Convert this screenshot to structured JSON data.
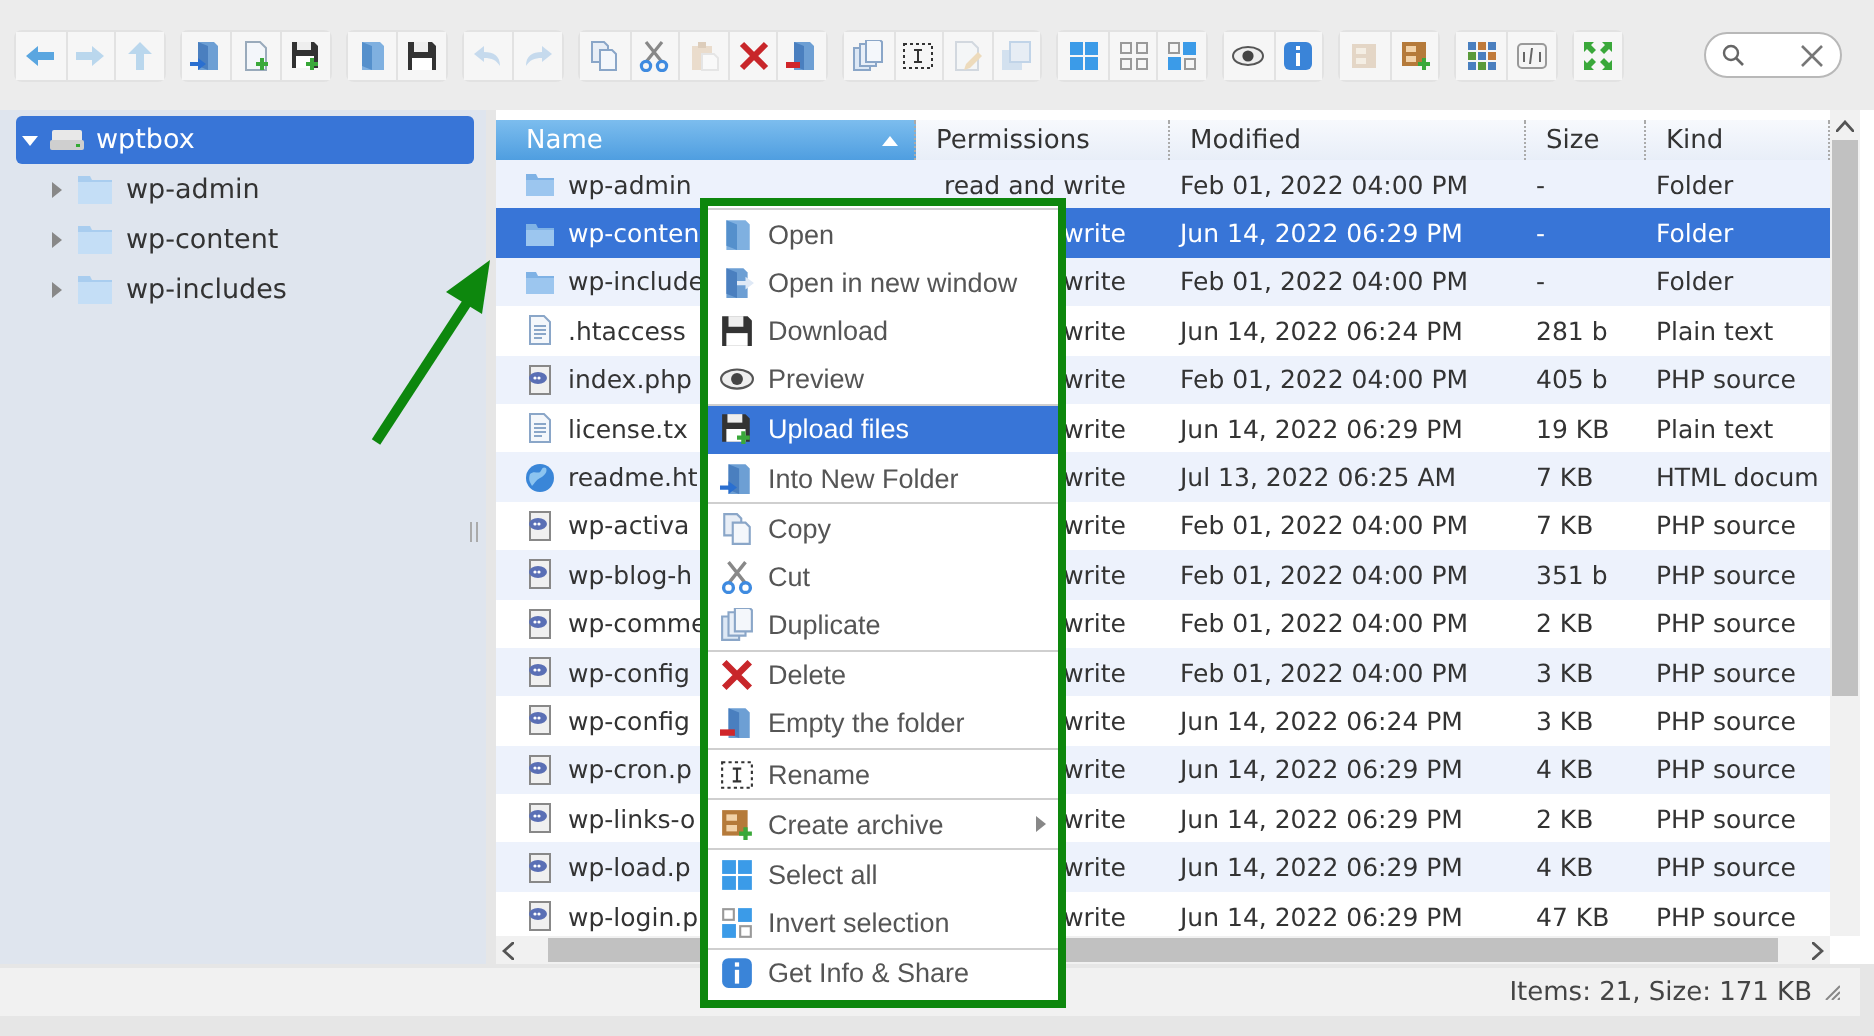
{
  "toolbar": {
    "groups": [
      [
        {
          "kind": "back",
          "disabled": false
        },
        {
          "kind": "forward",
          "disabled": true
        },
        {
          "kind": "up",
          "disabled": true
        }
      ],
      [
        {
          "kind": "mkdir",
          "disabled": false
        },
        {
          "kind": "mkfile",
          "disabled": false
        },
        {
          "kind": "upload",
          "disabled": false
        }
      ],
      [
        {
          "kind": "open",
          "disabled": false
        },
        {
          "kind": "download",
          "disabled": false
        }
      ],
      [
        {
          "kind": "undo",
          "disabled": true
        },
        {
          "kind": "redo",
          "disabled": true
        }
      ],
      [
        {
          "kind": "copy",
          "disabled": false
        },
        {
          "kind": "cut",
          "disabled": false
        },
        {
          "kind": "paste",
          "disabled": true
        },
        {
          "kind": "delete",
          "disabled": false
        },
        {
          "kind": "empty",
          "disabled": false
        }
      ],
      [
        {
          "kind": "duplicate",
          "disabled": false
        },
        {
          "kind": "rename",
          "disabled": false
        },
        {
          "kind": "edit",
          "disabled": true
        },
        {
          "kind": "resize",
          "disabled": true
        }
      ],
      [
        {
          "kind": "selectall",
          "disabled": false
        },
        {
          "kind": "selectnone",
          "disabled": false
        },
        {
          "kind": "selectinvert",
          "disabled": false
        }
      ],
      [
        {
          "kind": "preview",
          "disabled": false
        },
        {
          "kind": "info",
          "disabled": false
        }
      ],
      [
        {
          "kind": "extract",
          "disabled": true
        },
        {
          "kind": "archive",
          "disabled": false
        }
      ],
      [
        {
          "kind": "view",
          "disabled": false
        },
        {
          "kind": "sort",
          "disabled": false
        }
      ],
      [
        {
          "kind": "fullscreen",
          "disabled": false
        }
      ]
    ]
  },
  "tree": {
    "root": {
      "label": "wptbox",
      "selected": true,
      "expanded": true,
      "children": [
        {
          "label": "wp-admin",
          "selected": false,
          "expanded": false
        },
        {
          "label": "wp-content",
          "selected": false,
          "expanded": false
        },
        {
          "label": "wp-includes",
          "selected": false,
          "expanded": false
        }
      ]
    }
  },
  "table": {
    "columns": [
      {
        "label": "Name",
        "sorted": true
      },
      {
        "label": "Permissions",
        "sorted": false
      },
      {
        "label": "Modified",
        "sorted": false
      },
      {
        "label": "Size",
        "sorted": false
      },
      {
        "label": "Kind",
        "sorted": false
      }
    ],
    "rows": [
      {
        "kind": "folder",
        "name": "wp-admin",
        "permissions": "read and write",
        "modified": "Feb 01, 2022 04:00 PM",
        "size": "-",
        "file_type": "Folder",
        "selected": false
      },
      {
        "kind": "folder",
        "name": "wp-conten",
        "permissions": "write",
        "modified": "Jun 14, 2022 06:29 PM",
        "size": "-",
        "file_type": "Folder",
        "selected": true
      },
      {
        "kind": "folder",
        "name": "wp-include",
        "permissions": "write",
        "modified": "Feb 01, 2022 04:00 PM",
        "size": "-",
        "file_type": "Folder",
        "selected": false
      },
      {
        "kind": "text",
        "name": ".htaccess",
        "permissions": "write",
        "modified": "Jun 14, 2022 06:24 PM",
        "size": "281 b",
        "file_type": "Plain text",
        "selected": false
      },
      {
        "kind": "php",
        "name": "index.php",
        "permissions": "write",
        "modified": "Feb 01, 2022 04:00 PM",
        "size": "405 b",
        "file_type": "PHP source",
        "selected": false
      },
      {
        "kind": "text",
        "name": "license.tx",
        "permissions": "write",
        "modified": "Jun 14, 2022 06:29 PM",
        "size": "19 KB",
        "file_type": "Plain text",
        "selected": false
      },
      {
        "kind": "html",
        "name": "readme.ht",
        "permissions": "write",
        "modified": "Jul 13, 2022 06:25 AM",
        "size": "7 KB",
        "file_type": "HTML docum",
        "selected": false
      },
      {
        "kind": "php",
        "name": "wp-activa",
        "permissions": "write",
        "modified": "Feb 01, 2022 04:00 PM",
        "size": "7 KB",
        "file_type": "PHP source",
        "selected": false
      },
      {
        "kind": "php",
        "name": "wp-blog-h",
        "permissions": "write",
        "modified": "Feb 01, 2022 04:00 PM",
        "size": "351 b",
        "file_type": "PHP source",
        "selected": false
      },
      {
        "kind": "php",
        "name": "wp-comme",
        "permissions": "write",
        "modified": "Feb 01, 2022 04:00 PM",
        "size": "2 KB",
        "file_type": "PHP source",
        "selected": false
      },
      {
        "kind": "php",
        "name": "wp-config",
        "permissions": "write",
        "modified": "Feb 01, 2022 04:00 PM",
        "size": "3 KB",
        "file_type": "PHP source",
        "selected": false
      },
      {
        "kind": "php",
        "name": "wp-config",
        "permissions": "write",
        "modified": "Jun 14, 2022 06:24 PM",
        "size": "3 KB",
        "file_type": "PHP source",
        "selected": false
      },
      {
        "kind": "php",
        "name": "wp-cron.p",
        "permissions": "write",
        "modified": "Jun 14, 2022 06:29 PM",
        "size": "4 KB",
        "file_type": "PHP source",
        "selected": false
      },
      {
        "kind": "php",
        "name": "wp-links-o",
        "permissions": "write",
        "modified": "Jun 14, 2022 06:29 PM",
        "size": "2 KB",
        "file_type": "PHP source",
        "selected": false
      },
      {
        "kind": "php",
        "name": "wp-load.p",
        "permissions": "write",
        "modified": "Jun 14, 2022 06:29 PM",
        "size": "4 KB",
        "file_type": "PHP source",
        "selected": false
      },
      {
        "kind": "php",
        "name": "wp-login.p",
        "permissions": "write",
        "modified": "Jun 14, 2022 06:29 PM",
        "size": "47 KB",
        "file_type": "PHP source",
        "selected": false
      }
    ]
  },
  "context_menu": {
    "groups": [
      [
        {
          "kind": "open",
          "label": "Open",
          "selected": false,
          "submenu": false
        },
        {
          "kind": "openwin",
          "label": "Open in new window",
          "selected": false,
          "submenu": false
        },
        {
          "kind": "download",
          "label": "Download",
          "selected": false,
          "submenu": false
        },
        {
          "kind": "preview",
          "label": "Preview",
          "selected": false,
          "submenu": false
        }
      ],
      [
        {
          "kind": "upload",
          "label": "Upload files",
          "selected": true,
          "submenu": false
        },
        {
          "kind": "mkdir",
          "label": "Into New Folder",
          "selected": false,
          "submenu": false
        }
      ],
      [
        {
          "kind": "copy",
          "label": "Copy",
          "selected": false,
          "submenu": false
        },
        {
          "kind": "cut",
          "label": "Cut",
          "selected": false,
          "submenu": false
        },
        {
          "kind": "duplicate",
          "label": "Duplicate",
          "selected": false,
          "submenu": false
        }
      ],
      [
        {
          "kind": "delete",
          "label": "Delete",
          "selected": false,
          "submenu": false
        },
        {
          "kind": "empty",
          "label": "Empty the folder",
          "selected": false,
          "submenu": false
        }
      ],
      [
        {
          "kind": "rename",
          "label": "Rename",
          "selected": false,
          "submenu": false
        }
      ],
      [
        {
          "kind": "archive",
          "label": "Create archive",
          "selected": false,
          "submenu": true
        }
      ],
      [
        {
          "kind": "selectall",
          "label": "Select all",
          "selected": false,
          "submenu": false
        },
        {
          "kind": "selectinvert",
          "label": "Invert selection",
          "selected": false,
          "submenu": false
        }
      ],
      [
        {
          "kind": "info",
          "label": "Get Info & Share",
          "selected": false,
          "submenu": false
        }
      ]
    ]
  },
  "status_bar": {
    "text": "Items: 21, Size: 171 KB"
  }
}
